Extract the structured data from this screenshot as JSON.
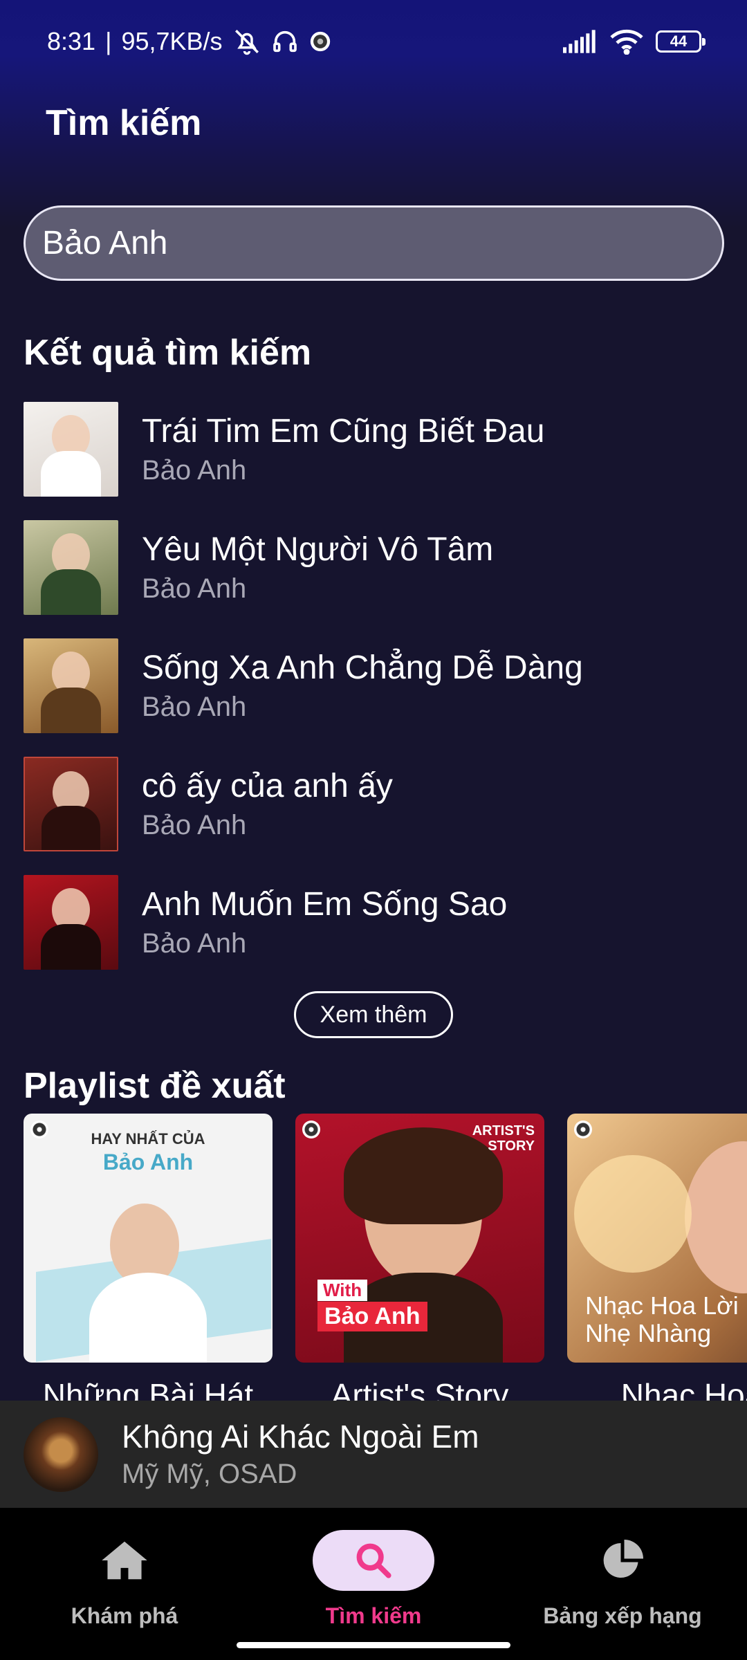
{
  "status_bar": {
    "time": "8:31",
    "separator": "|",
    "speed": "95,7KB/s",
    "battery": "44",
    "icons": [
      "bell-off-icon",
      "headphones-icon",
      "app-notification-icon",
      "signal-icon",
      "wifi-icon",
      "battery-icon"
    ]
  },
  "header": {
    "title": "Tìm kiếm"
  },
  "search": {
    "value": "Bảo Anh"
  },
  "results": {
    "title": "Kết quả tìm kiếm",
    "items": [
      {
        "title": "Trái Tim Em Cũng Biết Đau",
        "artist": "Bảo Anh"
      },
      {
        "title": "Yêu Một Người Vô Tâm",
        "artist": "Bảo Anh"
      },
      {
        "title": "Sống Xa Anh Chẳng Dễ Dàng",
        "artist": "Bảo Anh"
      },
      {
        "title": "cô ấy của anh ấy",
        "artist": "Bảo Anh"
      },
      {
        "title": "Anh Muốn Em Sống Sao",
        "artist": "Bảo Anh"
      }
    ],
    "more_label": "Xem thêm"
  },
  "playlists": {
    "title": "Playlist đề xuất",
    "items": [
      {
        "name": "Những Bài Hát",
        "cover_line1": "HAY NHẤT CỦA",
        "cover_line2": "Bảo Anh"
      },
      {
        "name": "Artist's Story",
        "cover_badge": "ARTIST'S STORY",
        "cover_with": "With",
        "cover_name": "Bảo Anh"
      },
      {
        "name": "Nhạc Hoa",
        "cover_line1": "Nhạc Hoa Lời",
        "cover_line2": "Nhẹ Nhàng"
      }
    ]
  },
  "now_playing": {
    "title": "Không Ai Khác Ngoài Em",
    "artist": "Mỹ Mỹ, OSAD"
  },
  "nav": {
    "items": [
      {
        "label": "Khám phá",
        "icon": "home-icon"
      },
      {
        "label": "Tìm kiếm",
        "icon": "search-icon",
        "active": true
      },
      {
        "label": "Bảng xếp hạng",
        "icon": "pie-chart-icon"
      }
    ]
  },
  "colors": {
    "accent": "#f03a8c",
    "active_pill": "#ecdcf7",
    "background": "#16142e",
    "header_gradient": "#141478"
  }
}
